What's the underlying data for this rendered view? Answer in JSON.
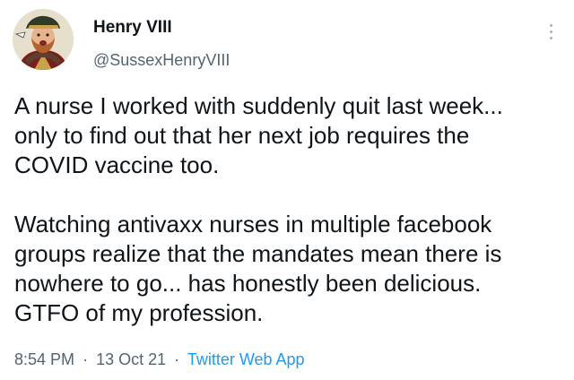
{
  "author": {
    "display_name": "Henry VIII",
    "handle": "@SussexHenryVIII",
    "avatar_icon": "king-portrait-avatar"
  },
  "tweet": {
    "paragraphs": [
      "A nurse I worked with suddenly quit last week...\nonly to find out that her next job requires the\nCOVID vaccine too.",
      "Watching antivaxx nurses in multiple facebook\ngroups realize that the mandates mean there is\nnowhere to go... has honestly been delicious.\nGTFO of my profession."
    ]
  },
  "meta": {
    "time": "8:54 PM",
    "separator": "·",
    "date": "13 Oct 21",
    "source": "Twitter Web App"
  },
  "colors": {
    "text": "#0f1419",
    "secondary": "#536471",
    "link": "#1d9bf0"
  }
}
